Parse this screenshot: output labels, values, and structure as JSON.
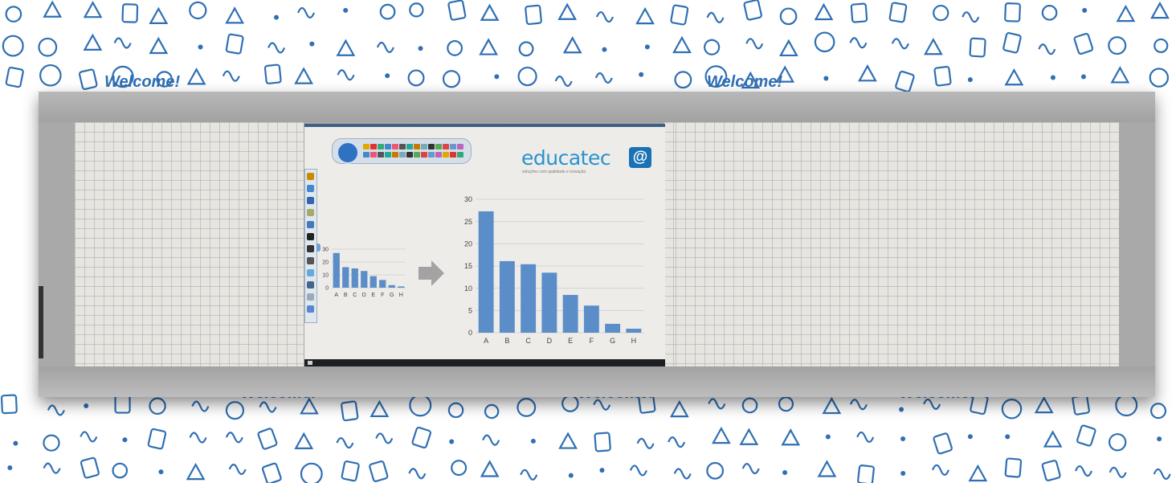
{
  "background": {
    "pattern_color": "#2f6fb3",
    "banner_text": "Welcome!"
  },
  "screen": {
    "brand": {
      "name": "educatec",
      "symbol": "@",
      "tagline": "soluções com qualidade e inovação",
      "color": "#2a92cf"
    },
    "arrow_color": "#a3a3a3",
    "bar_color": "#5b8ec8"
  },
  "chart_data": [
    {
      "type": "bar",
      "categories": [
        "A",
        "B",
        "C",
        "D",
        "E",
        "F",
        "G",
        "H"
      ],
      "values": [
        27,
        16,
        15,
        13,
        9,
        6,
        2,
        1
      ],
      "ylim": [
        0,
        30
      ],
      "yticks": [
        0,
        10,
        20,
        30
      ],
      "grid": true
    },
    {
      "type": "bar",
      "categories": [
        "A",
        "B",
        "C",
        "D",
        "E",
        "F",
        "G",
        "H"
      ],
      "values": [
        27.3,
        16.1,
        15.4,
        13.5,
        8.5,
        6.1,
        2.0,
        0.9
      ],
      "ylim": [
        0,
        30
      ],
      "yticks": [
        0,
        5,
        10,
        15,
        20,
        25,
        30
      ],
      "grid": true
    }
  ]
}
